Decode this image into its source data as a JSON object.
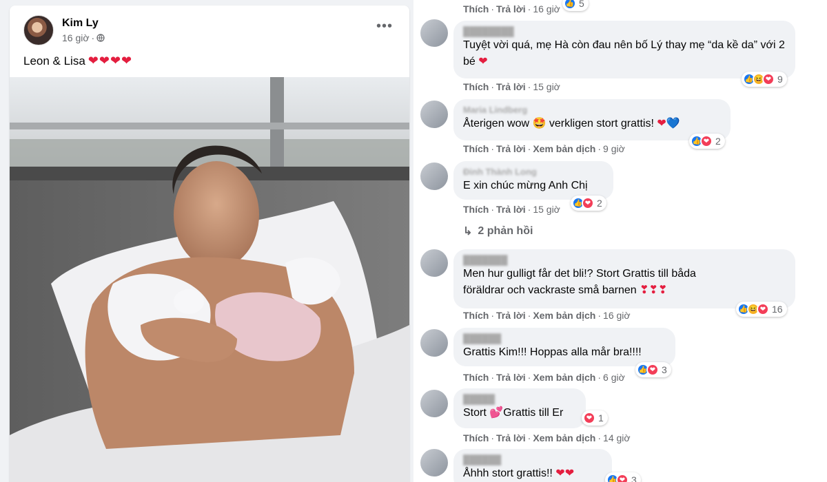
{
  "post": {
    "author": "Kim Ly",
    "time": "16 giờ",
    "caption": "Leon & Lisa",
    "caption_hearts": "❤❤❤❤",
    "more": "•••"
  },
  "comments": [
    {
      "text": "Tuyệt vời quá, mẹ Hà còn đau nên bố Lý thay mẹ “da kề da” với 2 bé",
      "suffix": "❤",
      "actions": [
        "Thích",
        "Trả lời"
      ],
      "time": "15 giờ",
      "reactions": [
        "like",
        "haha",
        "love"
      ],
      "count": "9"
    },
    {
      "name": "Maria Lindberg",
      "text": "Återigen wow 🤩 verkligen stort grattis!",
      "suffix": "❤💙",
      "actions": [
        "Thích",
        "Trả lời",
        "Xem bản dịch"
      ],
      "time": "9 giờ",
      "reactions": [
        "like",
        "love"
      ],
      "count": "2"
    },
    {
      "name": "Đinh Thành Long",
      "text": "E xin chúc mừng Anh Chị",
      "suffix": "",
      "actions": [
        "Thích",
        "Trả lời"
      ],
      "time": "15 giờ",
      "reactions": [
        "like",
        "love"
      ],
      "count": "2",
      "replies": "2 phản hồi"
    },
    {
      "text_line1": "Men hur gulligt får det bli!? Stort Grattis till båda",
      "text_line2": "föräldrar och vackraste små barnen",
      "suffix": "❣❣❣",
      "actions": [
        "Thích",
        "Trả lời",
        "Xem bản dịch"
      ],
      "time": "16 giờ",
      "reactions": [
        "like",
        "haha",
        "love"
      ],
      "count": "16"
    },
    {
      "text": "Grattis Kim!!! Hoppas alla mår bra!!!!",
      "actions": [
        "Thích",
        "Trả lời",
        "Xem bản dịch"
      ],
      "time": "6 giờ",
      "reactions": [
        "like",
        "love"
      ],
      "count": "3"
    },
    {
      "text_a": "Stort",
      "heart": "💕",
      "text_b": "Grattis till Er",
      "actions": [
        "Thích",
        "Trả lời",
        "Xem bản dịch"
      ],
      "time": "14 giờ",
      "reactions": [
        "love"
      ],
      "count": "1"
    },
    {
      "text": "Åhhh stort grattis!!",
      "suffix": "❤❤",
      "reactions": [
        "like",
        "love"
      ],
      "count": "3"
    }
  ],
  "top_actions": {
    "like": "Thích",
    "reply": "Trả lời",
    "time": "16 giờ",
    "count": "5"
  },
  "colors": {
    "like": "#1877f2",
    "love": "#f33e58",
    "haha": "#f7b125",
    "meta": "#65676b",
    "bubble": "#f0f2f5"
  }
}
